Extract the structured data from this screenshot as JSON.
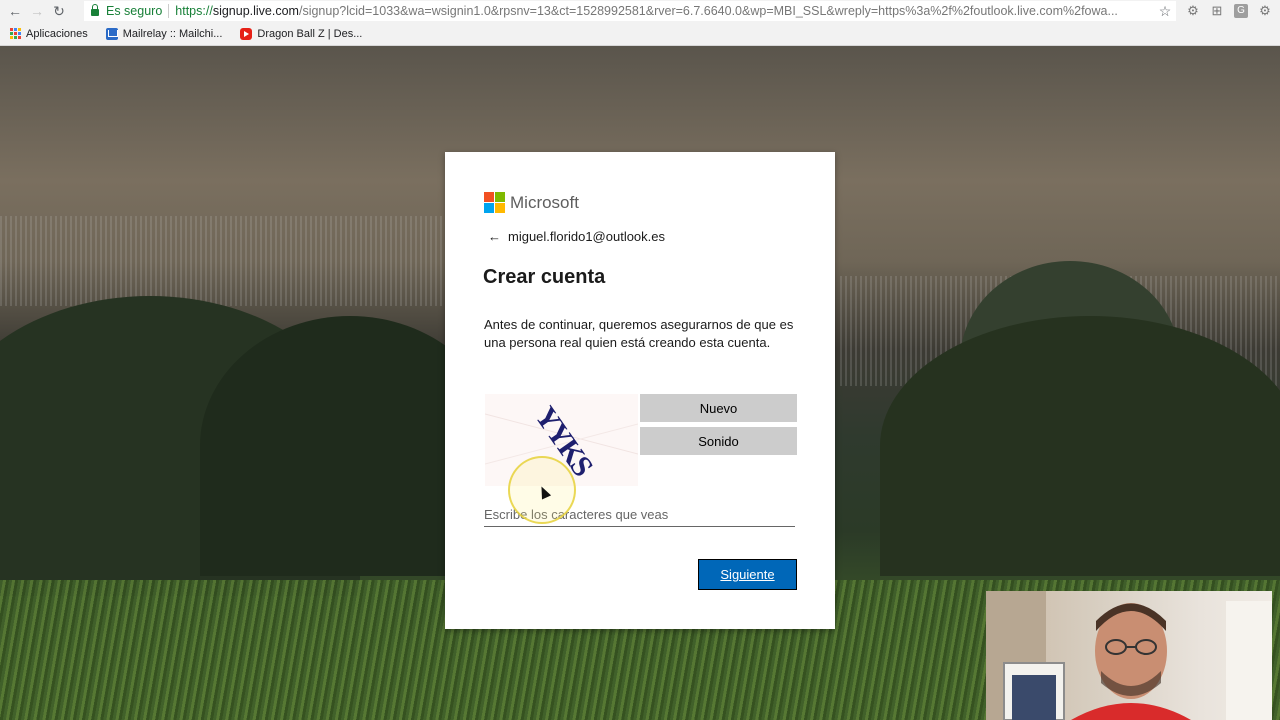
{
  "browser": {
    "security_label": "Es seguro",
    "url_scheme": "https://",
    "url_host": "signup.live.com",
    "url_rest": "/signup?lcid=1033&wa=wsignin1.0&rpsnv=13&ct=1528992581&rver=6.7.6640.0&wp=MBI_SSL&wreply=https%3a%2f%2foutlook.live.com%2fowa...",
    "bookmarks": [
      {
        "label": "Aplicaciones",
        "icon": "apps-grid-icon"
      },
      {
        "label": "Mailrelay :: Mailchi...",
        "icon": "mailrelay-icon"
      },
      {
        "label": "Dragon Ball Z | Des...",
        "icon": "youtube-icon"
      }
    ]
  },
  "dialog": {
    "brand": "Microsoft",
    "identity_email": "miguel.florido1@outlook.es",
    "title": "Crear cuenta",
    "description": "Antes de continuar, queremos asegurarnos de que es una persona real quien está creando esta cuenta.",
    "captcha_text": "YYKS",
    "new_button": "Nuevo",
    "audio_button": "Sonido",
    "input_placeholder": "Escribe los caracteres que veas",
    "input_value": "",
    "next_button": "Siguiente"
  },
  "colors": {
    "accent": "#0067b8",
    "secure": "#188038",
    "ms_red": "#f25022",
    "ms_green": "#7fba00",
    "ms_blue": "#00a4ef",
    "ms_yellow": "#ffb900"
  }
}
